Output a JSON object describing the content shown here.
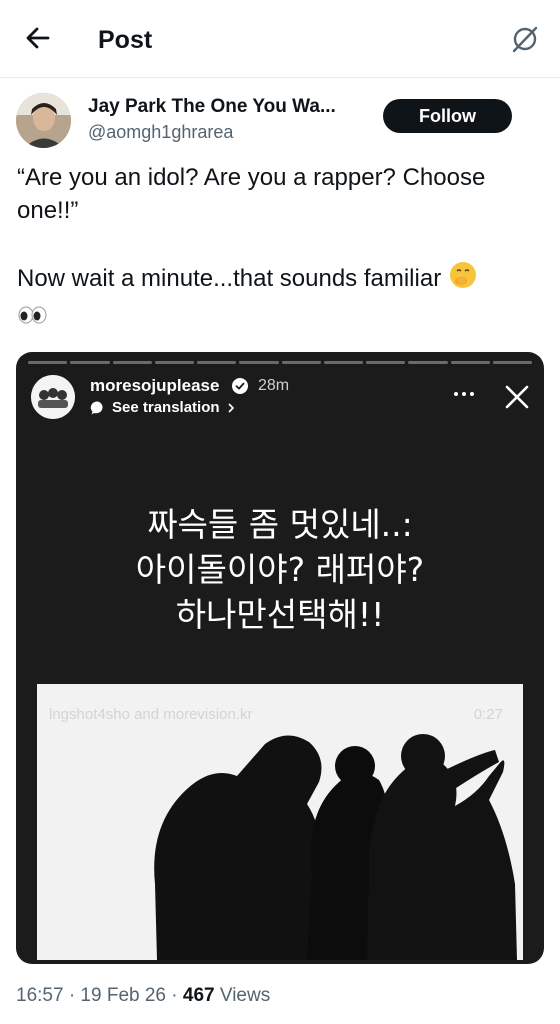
{
  "header": {
    "title": "Post"
  },
  "post": {
    "author_name": "Jay Park The One You Wa...",
    "author_handle": "@aomgh1ghrarea",
    "follow_label": "Follow",
    "text_line1": "“Are you an idol? Are you a rapper? Choose one!!”",
    "text_line2": "Now wait a minute...that sounds familiar",
    "timestamp": "16:57 · 19 Feb 26 · ",
    "views_count": "467",
    "views_label": " Views"
  },
  "story": {
    "username": "moresojuplease",
    "time": "28m",
    "see_translation": "See translation",
    "korean_line1": "짜슥들 좀 멋있네..:",
    "korean_line2": "아이돌이야? 래퍼야?",
    "korean_line3": "하나만선택해!!",
    "progress_segments": 12
  },
  "video": {
    "watermark": "lngshot4sho and morevision.kr",
    "duration": "0:27"
  },
  "icons": {
    "back": "arrow-left-icon",
    "grok": "grok-icon",
    "verified": "verified-badge-icon",
    "translate": "translate-bubble-icon",
    "more": "more-horizontal-icon",
    "close": "close-icon",
    "emoji_1": "shushing-face-emoji",
    "emoji_2": "eyes-emoji"
  },
  "colors": {
    "text": "#0f1419",
    "secondary": "#536471",
    "follow_bg": "#0f1419",
    "story_bg": "#1b1b1b"
  }
}
